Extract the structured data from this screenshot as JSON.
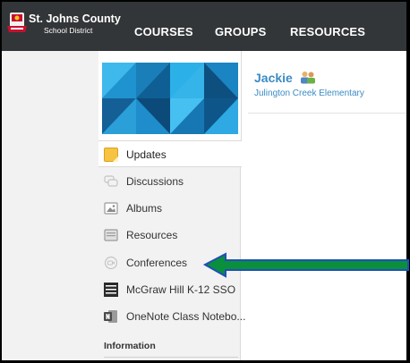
{
  "topbar": {
    "district_name": "St. Johns County",
    "district_sub": "School District",
    "nav": [
      {
        "label": "COURSES"
      },
      {
        "label": "GROUPS"
      },
      {
        "label": "RESOURCES"
      }
    ]
  },
  "sidebar": {
    "items": [
      {
        "label": "Updates",
        "icon": "updates-icon"
      },
      {
        "label": "Discussions",
        "icon": "discussions-icon"
      },
      {
        "label": "Albums",
        "icon": "albums-icon"
      },
      {
        "label": "Resources",
        "icon": "resources-icon"
      },
      {
        "label": "Conferences",
        "icon": "conferences-icon"
      },
      {
        "label": "McGraw Hill K-12 SSO",
        "icon": "mcgraw-hill-icon"
      },
      {
        "label": "OneNote Class Notebo...",
        "icon": "onenote-icon"
      }
    ],
    "info_header": "Information"
  },
  "profile": {
    "name": "Jackie",
    "school": "Julington Creek Elementary"
  },
  "colors": {
    "topbar": "#333638",
    "link": "#3b8bc4",
    "arrow_fill": "#0a8f3c",
    "arrow_outline": "#1f4fb8"
  }
}
